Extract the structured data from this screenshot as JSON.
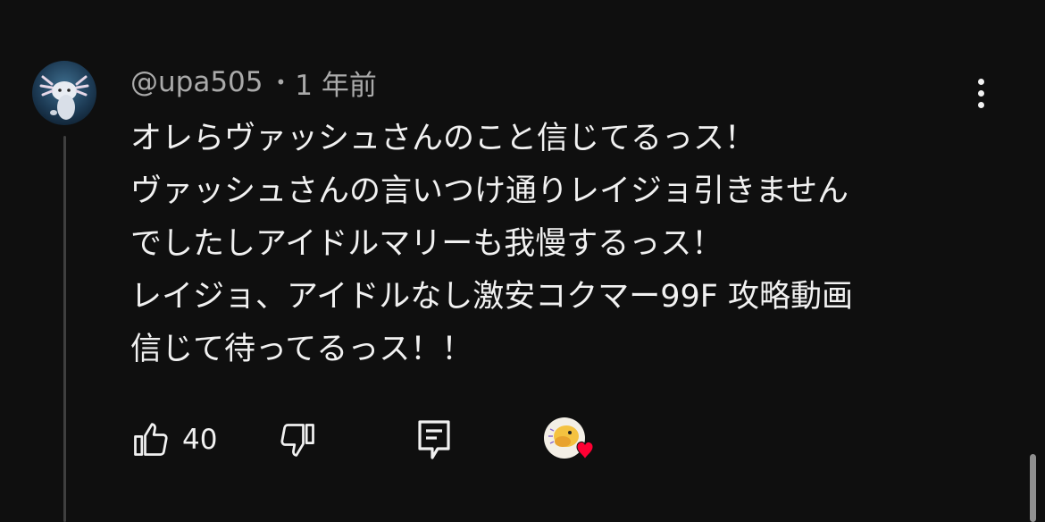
{
  "comment": {
    "author": "@upa505",
    "separator": "•",
    "timestamp": "1 年前",
    "lines": [
      "オレらヴァッシュさんのこと信じてるっス！",
      "ヴァッシュさんの言いつけ通りレイジョ引きません",
      "でしたしアイドルマリーも我慢するっス！",
      "レイジョ、アイドルなし激安コクマー99F 攻略動画",
      "信じて待ってるっス！！"
    ],
    "like_count": "40"
  },
  "icons": {
    "menu": "more-vertical-icon",
    "like": "thumbs-up-icon",
    "dislike": "thumbs-down-icon",
    "reply": "reply-comment-icon",
    "creator_heart": "creator-heart-icon"
  },
  "colors": {
    "background": "#0f0f0f",
    "text": "#f1f1f1",
    "secondary_text": "#aaaaaa",
    "heart": "#ff0033"
  }
}
